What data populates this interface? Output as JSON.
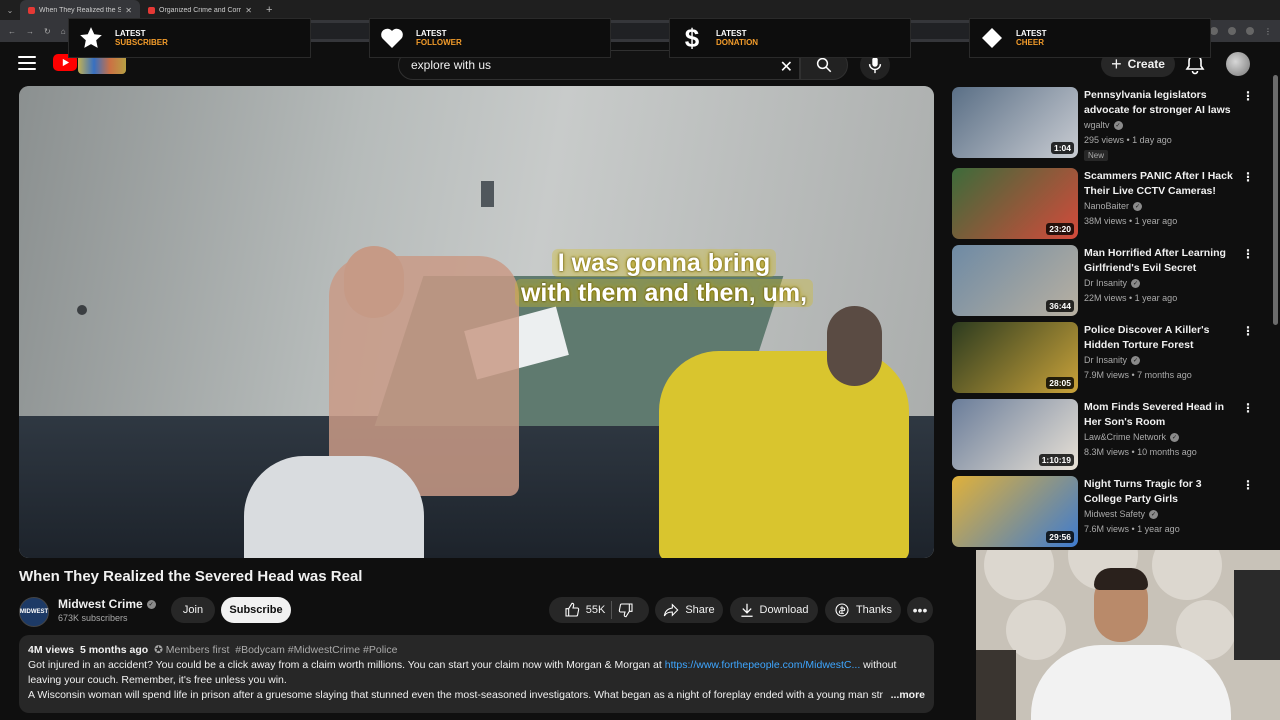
{
  "browser": {
    "tabs": [
      {
        "title": "When They Realized the Se",
        "active": true
      },
      {
        "title": "Organized Crime and Corruptio",
        "active": false
      }
    ],
    "url": "/watch?v=thZ2EhXP89U"
  },
  "overlays": [
    {
      "icon": "star-icon",
      "line1": "LATEST",
      "line2": "SUBSCRIBER"
    },
    {
      "icon": "heart-icon",
      "line1": "LATEST",
      "line2": "FOLLOWER"
    },
    {
      "icon": "dollar-icon",
      "line1": "LATEST",
      "line2": "DONATION"
    },
    {
      "icon": "diamond-icon",
      "line1": "LATEST",
      "line2": "CHEER"
    }
  ],
  "masthead": {
    "search_value": "explore with us",
    "create_label": "Create"
  },
  "player": {
    "caption_line1": "I was gonna bring",
    "caption_line2": "with them and then, um,"
  },
  "video": {
    "title": "When They Realized the Severed Head was Real",
    "channel": "Midwest Crime",
    "subscribers": "673K subscribers",
    "avatar_text": "MIDWEST",
    "join_label": "Join",
    "subscribe_label": "Subscribe",
    "likes": "55K",
    "share_label": "Share",
    "download_label": "Download",
    "thanks_label": "Thanks"
  },
  "description": {
    "views": "4M views",
    "age": "5 months ago",
    "members": "Members first",
    "tags": "#Bodycam #MidwestCrime #Police",
    "text1": "Got injured in an accident? You could be a click away from a claim worth millions. You can start your claim now with Morgan & Morgan at",
    "link": "https://www.forthepeople.com/MidwestC...",
    "text1_end": "without",
    "text2": "leaving your couch. Remember, it's free unless you win.",
    "text3": "A Wisconsin woman will spend life in prison after a gruesome slaying that stunned even the most-seasoned investigators. What began as a night of foreplay ended with a young man str",
    "more": "...more"
  },
  "recommendations": [
    {
      "title": "Pennsylvania legislators advocate for stronger AI laws t...",
      "channel": "wgaltv",
      "meta": "295 views • 1 day ago",
      "duration": "1:04",
      "badge": "New",
      "colors": [
        "#5a6f86",
        "#c9ccd2"
      ]
    },
    {
      "title": "Scammers PANIC After I Hack Their Live CCTV Cameras!",
      "channel": "NanoBaiter",
      "meta": "38M views • 1 year ago",
      "duration": "23:20",
      "badge": "",
      "colors": [
        "#3c6b3a",
        "#d44a3b"
      ]
    },
    {
      "title": "Man Horrified After Learning Girlfriend's Evil Secret",
      "channel": "Dr Insanity",
      "meta": "22M views • 1 year ago",
      "duration": "36:44",
      "badge": "",
      "colors": [
        "#6e8aa4",
        "#b8b0a1"
      ]
    },
    {
      "title": "Police Discover A Killer's Hidden Torture Forest",
      "channel": "Dr Insanity",
      "meta": "7.9M views • 7 months ago",
      "duration": "28:05",
      "badge": "",
      "colors": [
        "#2c3b1f",
        "#c9a23a"
      ]
    },
    {
      "title": "Mom Finds Severed Head in Her Son's Room",
      "channel": "Law&Crime Network",
      "meta": "8.3M views • 10 months ago",
      "duration": "1:10:19",
      "badge": "",
      "colors": [
        "#6a7d9a",
        "#e8e1d6"
      ]
    },
    {
      "title": "Night Turns Tragic for 3 College Party Girls",
      "channel": "Midwest Safety",
      "meta": "7.6M views • 1 year ago",
      "duration": "29:56",
      "badge": "",
      "colors": [
        "#e0b13a",
        "#3e7bcf"
      ]
    }
  ]
}
